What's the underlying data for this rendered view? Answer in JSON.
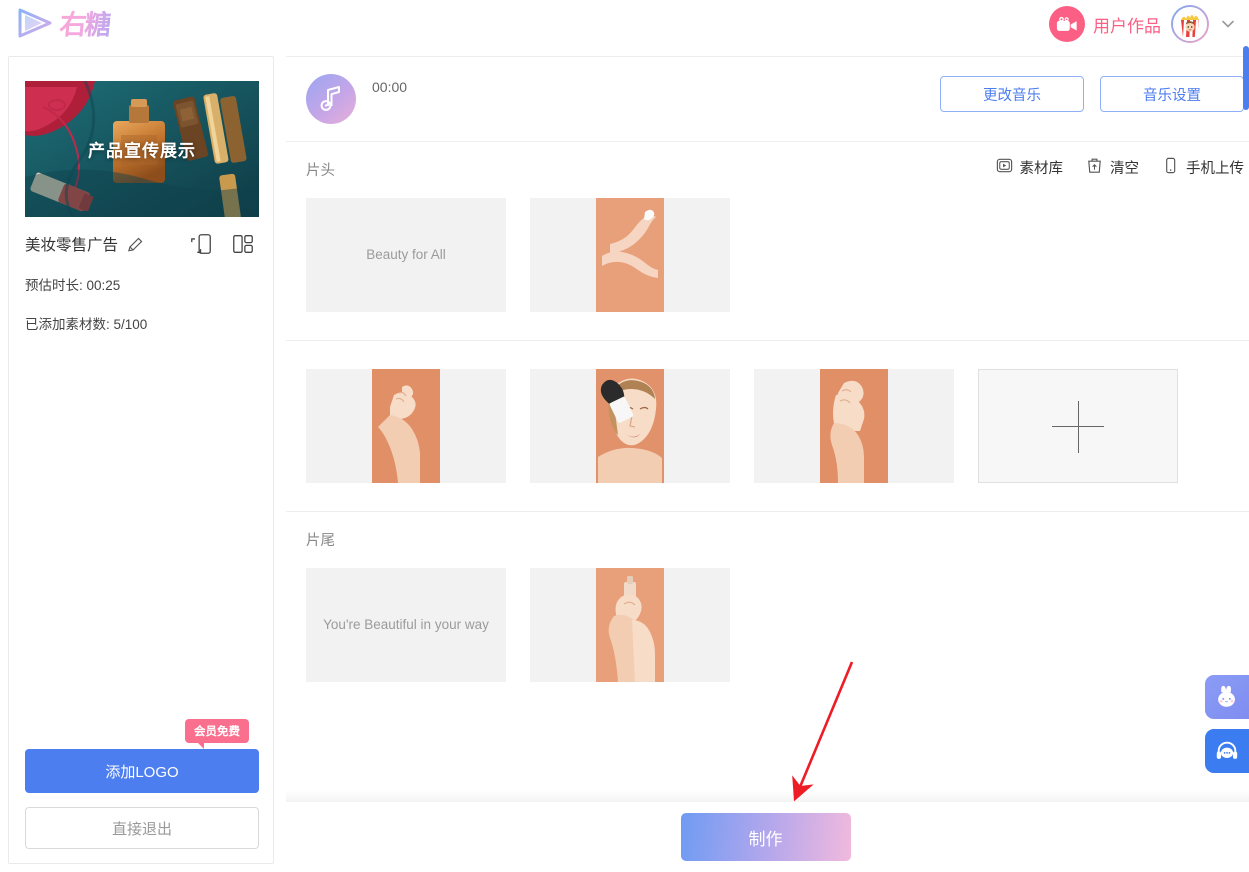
{
  "header": {
    "logo_text": "右糖",
    "logo_icon": "play-triangle-icon",
    "works_label": "用户作品",
    "works_icon": "video-camera-icon",
    "avatar_icon": "popcorn-crown-avatar",
    "chevron_icon": "chevron-down-icon"
  },
  "sidebar": {
    "thumbnail_title": "产品宣传展示",
    "project_name": "美妆零售广告",
    "edit_icon": "pencil-icon",
    "ratio_icon": "aspect-ratio-icon",
    "layout_icon": "layout-grid-icon",
    "duration_label": "预估时长: 00:25",
    "material_count_label": "已添加素材数: 5/100",
    "vip_badge": "会员免费",
    "add_logo_label": "添加LOGO",
    "exit_label": "直接退出"
  },
  "music": {
    "time": "00:00",
    "note_icon": "music-note-icon",
    "change_music_label": "更改音乐",
    "music_settings_label": "音乐设置"
  },
  "toolbar": {
    "library_label": "素材库",
    "library_icon": "video-library-icon",
    "clear_label": "清空",
    "clear_icon": "trash-icon",
    "upload_label": "手机上传",
    "upload_icon": "mobile-phone-icon"
  },
  "sections": {
    "opening_label": "片头",
    "ending_label": "片尾"
  },
  "clips": {
    "opening": [
      {
        "type": "text",
        "text": "Beauty for All"
      },
      {
        "type": "image",
        "alt": "hand-holding-product-peach-bg"
      }
    ],
    "middle": [
      {
        "type": "image",
        "alt": "hands-peach-bg"
      },
      {
        "type": "image",
        "alt": "woman-applying-makeup-brush"
      },
      {
        "type": "image",
        "alt": "hands-holding-peach-bg"
      },
      {
        "type": "add",
        "icon": "plus-icon"
      }
    ],
    "ending": [
      {
        "type": "text",
        "text": "You're Beautiful in your way"
      },
      {
        "type": "image",
        "alt": "hands-with-bottle-peach-bg"
      }
    ]
  },
  "footer": {
    "make_label": "制作"
  },
  "rail": {
    "mascot_icon": "rabbit-mascot-icon",
    "support_icon": "headset-support-icon"
  },
  "annotation": {
    "arrow_icon": "red-arrow-pointer",
    "arrow_color": "#ee1c25"
  },
  "colors": {
    "accent_blue": "#4d7ef0",
    "accent_pink": "#fb5f84",
    "badge_pink": "#fb6f8e",
    "panel_bg": "#f2f2f2"
  }
}
